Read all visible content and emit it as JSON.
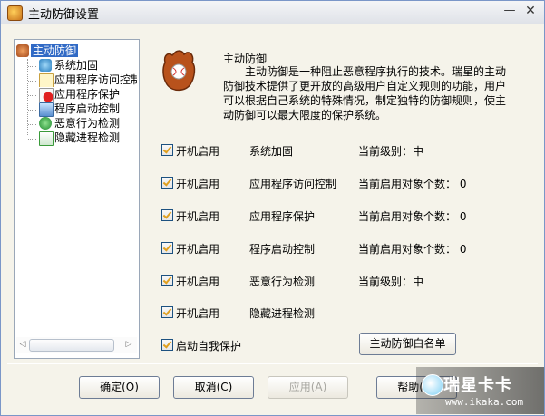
{
  "window": {
    "title": "主动防御设置",
    "min_glyph": "—",
    "close_glyph": "✕"
  },
  "tree": {
    "root": "主动防御",
    "items": [
      {
        "label": "系统加固",
        "icon": "system-harden-icon"
      },
      {
        "label": "应用程序访问控制",
        "icon": "app-access-icon"
      },
      {
        "label": "应用程序保护",
        "icon": "app-protect-icon"
      },
      {
        "label": "程序启动控制",
        "icon": "program-launch-icon"
      },
      {
        "label": "恶意行为检测",
        "icon": "malicious-detect-icon"
      },
      {
        "label": "隐藏进程检测",
        "icon": "hidden-process-icon"
      }
    ],
    "scroll_left": "◁",
    "scroll_right": "▷"
  },
  "description": {
    "title": "主动防御",
    "body": "主动防御是一种阻止恶意程序执行的技术。瑞星的主动防御技术提供了更开放的高级用户自定义规则的功能，用户可以根据自己系统的特殊情况，制定独特的防御规则，使主动防御可以最大限度的保护系统。"
  },
  "modules": [
    {
      "enable_label": "开机启用",
      "name": "系统加固",
      "status": "当前级别：中",
      "checked": true
    },
    {
      "enable_label": "开机启用",
      "name": "应用程序访问控制",
      "status": "当前启用对象个数： 0",
      "checked": true
    },
    {
      "enable_label": "开机启用",
      "name": "应用程序保护",
      "status": "当前启用对象个数： 0",
      "checked": true
    },
    {
      "enable_label": "开机启用",
      "name": "程序启动控制",
      "status": "当前启用对象个数： 0",
      "checked": true
    },
    {
      "enable_label": "开机启用",
      "name": "恶意行为检测",
      "status": "当前级别：中",
      "checked": true
    },
    {
      "enable_label": "开机启用",
      "name": "隐藏进程检测",
      "status": "",
      "checked": true
    }
  ],
  "self_protect": {
    "label": "启动自我保护",
    "checked": true
  },
  "whitelist_button": "主动防御白名单",
  "buttons": {
    "ok": "确定(O)",
    "cancel": "取消(C)",
    "apply": "应用(A)",
    "help": "帮助(H)"
  },
  "watermark": {
    "main": "瑞星卡卡",
    "url": "www.ikaka.com"
  },
  "colors": {
    "selection": "#316ac5",
    "check": "#e0a020",
    "window_bg": "#f5f3ea"
  }
}
